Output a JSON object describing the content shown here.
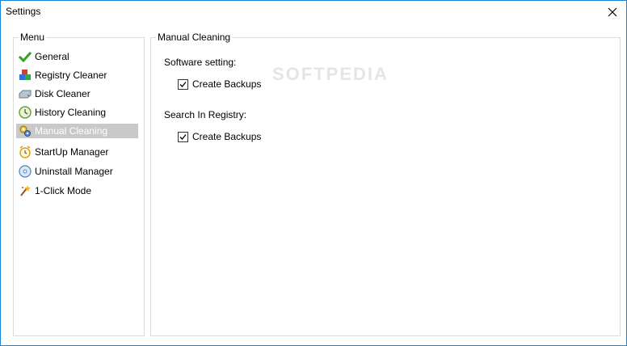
{
  "window": {
    "title": "Settings"
  },
  "menu": {
    "legend": "Menu",
    "items": [
      {
        "label": "General",
        "icon": "check-icon"
      },
      {
        "label": "Registry Cleaner",
        "icon": "registry-blocks-icon"
      },
      {
        "label": "Disk Cleaner",
        "icon": "disk-icon"
      },
      {
        "label": "History Cleaning",
        "icon": "clock-icon"
      },
      {
        "label": "Manual Cleaning",
        "icon": "gears-icon",
        "selected": true
      },
      {
        "label": "StartUp Manager",
        "icon": "alarm-clock-icon"
      },
      {
        "label": "Uninstall Manager",
        "icon": "uninstall-disc-icon"
      },
      {
        "label": "1-Click Mode",
        "icon": "magic-wand-icon"
      }
    ]
  },
  "content": {
    "legend": "Manual Cleaning",
    "software_setting": {
      "label": "Software setting:",
      "checkbox_label": "Create Backups",
      "checked": true
    },
    "registry_search": {
      "label": "Search In Registry:",
      "checkbox_label": "Create Backups",
      "checked": true
    },
    "watermark": "SOFTPEDIA"
  },
  "colors": {
    "window_border": "#1883d7",
    "selected_bg": "#c9c9c9"
  }
}
